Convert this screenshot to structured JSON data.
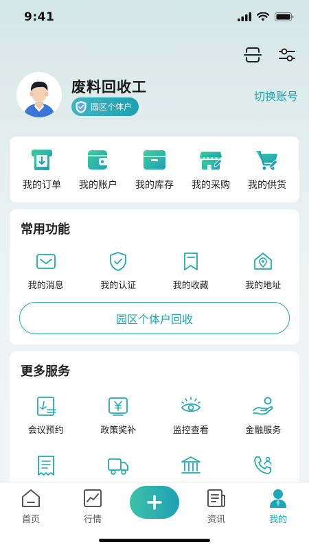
{
  "status_bar": {
    "time": "9:41"
  },
  "header": {
    "user_name": "废料回收工",
    "badge": "园区个体户",
    "switch_account": "切换账号"
  },
  "quick_actions": [
    {
      "label": "我的订单",
      "icon": "order-icon"
    },
    {
      "label": "我的账户",
      "icon": "wallet-icon"
    },
    {
      "label": "我的库存",
      "icon": "inventory-icon"
    },
    {
      "label": "我的采购",
      "icon": "store-icon"
    },
    {
      "label": "我的供货",
      "icon": "cart-icon"
    }
  ],
  "common_functions": {
    "title": "常用功能",
    "items": [
      {
        "label": "我的消息",
        "icon": "message-icon"
      },
      {
        "label": "我的认证",
        "icon": "shield-check-icon"
      },
      {
        "label": "我的收藏",
        "icon": "bookmark-icon"
      },
      {
        "label": "我的地址",
        "icon": "location-icon"
      }
    ],
    "button": "园区个体户回收"
  },
  "more_services": {
    "title": "更多服务",
    "row1": [
      {
        "label": "会议预约",
        "icon": "meeting-icon"
      },
      {
        "label": "政策奖补",
        "icon": "yen-icon"
      },
      {
        "label": "监控查看",
        "icon": "eye-icon"
      },
      {
        "label": "金融服务",
        "icon": "finance-icon"
      }
    ],
    "row2": [
      {
        "icon": "receipt-icon"
      },
      {
        "icon": "truck-icon"
      },
      {
        "icon": "bank-icon"
      },
      {
        "icon": "phone-icon"
      }
    ]
  },
  "tabbar": {
    "tabs": [
      {
        "label": "首页",
        "icon": "home-icon"
      },
      {
        "label": "行情",
        "icon": "chart-icon"
      },
      {
        "label": "资讯",
        "icon": "news-icon"
      },
      {
        "label": "我的",
        "icon": "user-icon",
        "active": true
      }
    ],
    "center_icon": "plus-icon"
  },
  "colors": {
    "accent": "#1aa7b6",
    "accent_green": "#2cb89e"
  }
}
